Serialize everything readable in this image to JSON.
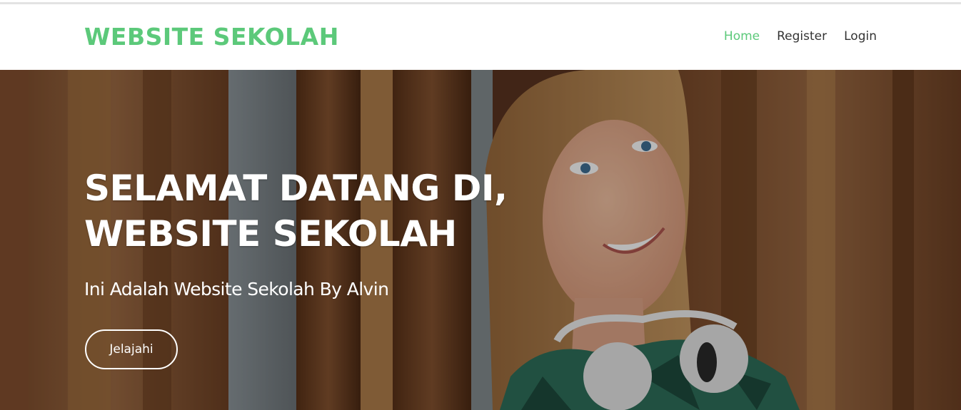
{
  "navbar": {
    "brand": "WEBSITE SEKOLAH",
    "links": [
      {
        "label": "Home",
        "active": true
      },
      {
        "label": "Register",
        "active": false
      },
      {
        "label": "Login",
        "active": false
      }
    ]
  },
  "hero": {
    "title_line1": "SELAMAT DATANG DI,",
    "title_line2": "WEBSITE SEKOLAH",
    "subtitle": "Ini Adalah Website Sekolah By Alvin",
    "button_label": "Jelajahi"
  },
  "colors": {
    "brand": "#5cc97a",
    "nav_text": "#333333",
    "hero_text": "#ffffff"
  }
}
